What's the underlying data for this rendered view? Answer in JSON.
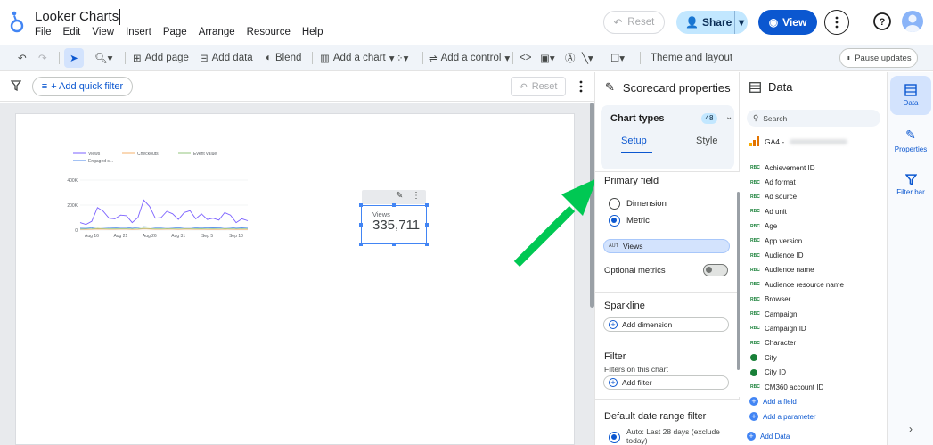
{
  "app": {
    "title": "Looker Charts",
    "menus": [
      "File",
      "Edit",
      "View",
      "Insert",
      "Page",
      "Arrange",
      "Resource",
      "Help"
    ],
    "reset_label": "Reset",
    "share_label": "Share",
    "view_label": "View"
  },
  "toolbar": {
    "add_page": "Add page",
    "add_data": "Add data",
    "blend": "Blend",
    "add_chart": "Add a chart",
    "add_control": "Add a control",
    "theme_layout": "Theme and layout",
    "pause_updates": "Pause updates"
  },
  "filterbar": {
    "quick_filter": "+ Add quick filter",
    "reset_label": "Reset"
  },
  "line_chart": {
    "legend": [
      "Views",
      "Checkouts",
      "Event value",
      "Engaged s..."
    ],
    "colors": [
      "#7b61ff",
      "#f6b26b",
      "#93c47d",
      "#4a86e8"
    ],
    "y_ticks": [
      "400K",
      "200K",
      "0"
    ],
    "x_ticks": [
      "Aug 16",
      "Aug 21",
      "Aug 26",
      "Aug 31",
      "Sep 5",
      "Sep 10"
    ]
  },
  "chart_data": {
    "type": "line",
    "title": "",
    "xlabel": "",
    "ylabel": "",
    "ylim": [
      0,
      400000
    ],
    "x": [
      "Aug 14",
      "Aug 15",
      "Aug 16",
      "Aug 17",
      "Aug 18",
      "Aug 19",
      "Aug 20",
      "Aug 21",
      "Aug 22",
      "Aug 23",
      "Aug 24",
      "Aug 25",
      "Aug 26",
      "Aug 27",
      "Aug 28",
      "Aug 29",
      "Aug 30",
      "Aug 31",
      "Sep 1",
      "Sep 2",
      "Sep 3",
      "Sep 4",
      "Sep 5",
      "Sep 6",
      "Sep 7",
      "Sep 8",
      "Sep 9",
      "Sep 10",
      "Sep 11",
      "Sep 12"
    ],
    "series": [
      {
        "name": "Views",
        "values": [
          60000,
          45000,
          70000,
          180000,
          150000,
          95000,
          90000,
          120000,
          115000,
          60000,
          100000,
          240000,
          190000,
          95000,
          100000,
          150000,
          130000,
          85000,
          140000,
          155000,
          90000,
          130000,
          85000,
          95000,
          80000,
          140000,
          120000,
          60000,
          90000,
          75000
        ]
      },
      {
        "name": "Checkouts",
        "values": [
          5000,
          5000,
          6000,
          8000,
          7000,
          6000,
          6000,
          7000,
          7000,
          5000,
          6000,
          9000,
          8000,
          6000,
          6000,
          7000,
          7000,
          5000,
          7000,
          7000,
          6000,
          7000,
          5000,
          6000,
          5000,
          7000,
          6000,
          5000,
          6000,
          5000
        ]
      },
      {
        "name": "Event value",
        "values": [
          8000,
          9000,
          10000,
          14000,
          12000,
          10000,
          10000,
          11000,
          11000,
          9000,
          10000,
          15000,
          13000,
          10000,
          10000,
          12000,
          11000,
          9000,
          12000,
          12000,
          10000,
          11000,
          9000,
          10000,
          9000,
          12000,
          11000,
          9000,
          10000,
          9000
        ]
      },
      {
        "name": "Engaged s...",
        "values": [
          15000,
          14000,
          18000,
          26000,
          22000,
          19000,
          18000,
          21000,
          21000,
          15000,
          19000,
          28000,
          25000,
          19000,
          19000,
          23000,
          21000,
          17000,
          22000,
          23000,
          18000,
          21000,
          17000,
          18000,
          17000,
          23000,
          21000,
          15000,
          18000,
          16000
        ]
      }
    ]
  },
  "scorecard": {
    "label": "Views",
    "value": "335,711"
  },
  "properties": {
    "title": "Scorecard properties",
    "chart_types": "Chart types",
    "chart_types_count": "48",
    "tab_setup": "Setup",
    "tab_style": "Style",
    "primary_field": "Primary field",
    "dimension": "Dimension",
    "metric": "Metric",
    "metric_chip": "Views",
    "chip_aut": "AUT",
    "optional_metrics": "Optional metrics",
    "sparkline": "Sparkline",
    "add_dimension": "Add dimension",
    "filter": "Filter",
    "filters_on_chart": "Filters on this chart",
    "add_filter": "Add filter",
    "date_range": "Default date range filter",
    "auto_label": "Auto: Last 28 days (exclude today)"
  },
  "data_panel": {
    "title": "Data",
    "search_placeholder": "Search",
    "source": "GA4 -",
    "fields": [
      "Achievement ID",
      "Ad format",
      "Ad source",
      "Ad unit",
      "Age",
      "App version",
      "Audience ID",
      "Audience name",
      "Audience resource name",
      "Browser",
      "Campaign",
      "Campaign ID",
      "Character",
      "City",
      "City ID",
      "CM360 account ID"
    ],
    "add_field": "Add a field",
    "add_parameter": "Add a parameter",
    "add_data": "Add Data"
  },
  "rail": {
    "data": "Data",
    "properties": "Properties",
    "filter_bar": "Filter bar"
  }
}
